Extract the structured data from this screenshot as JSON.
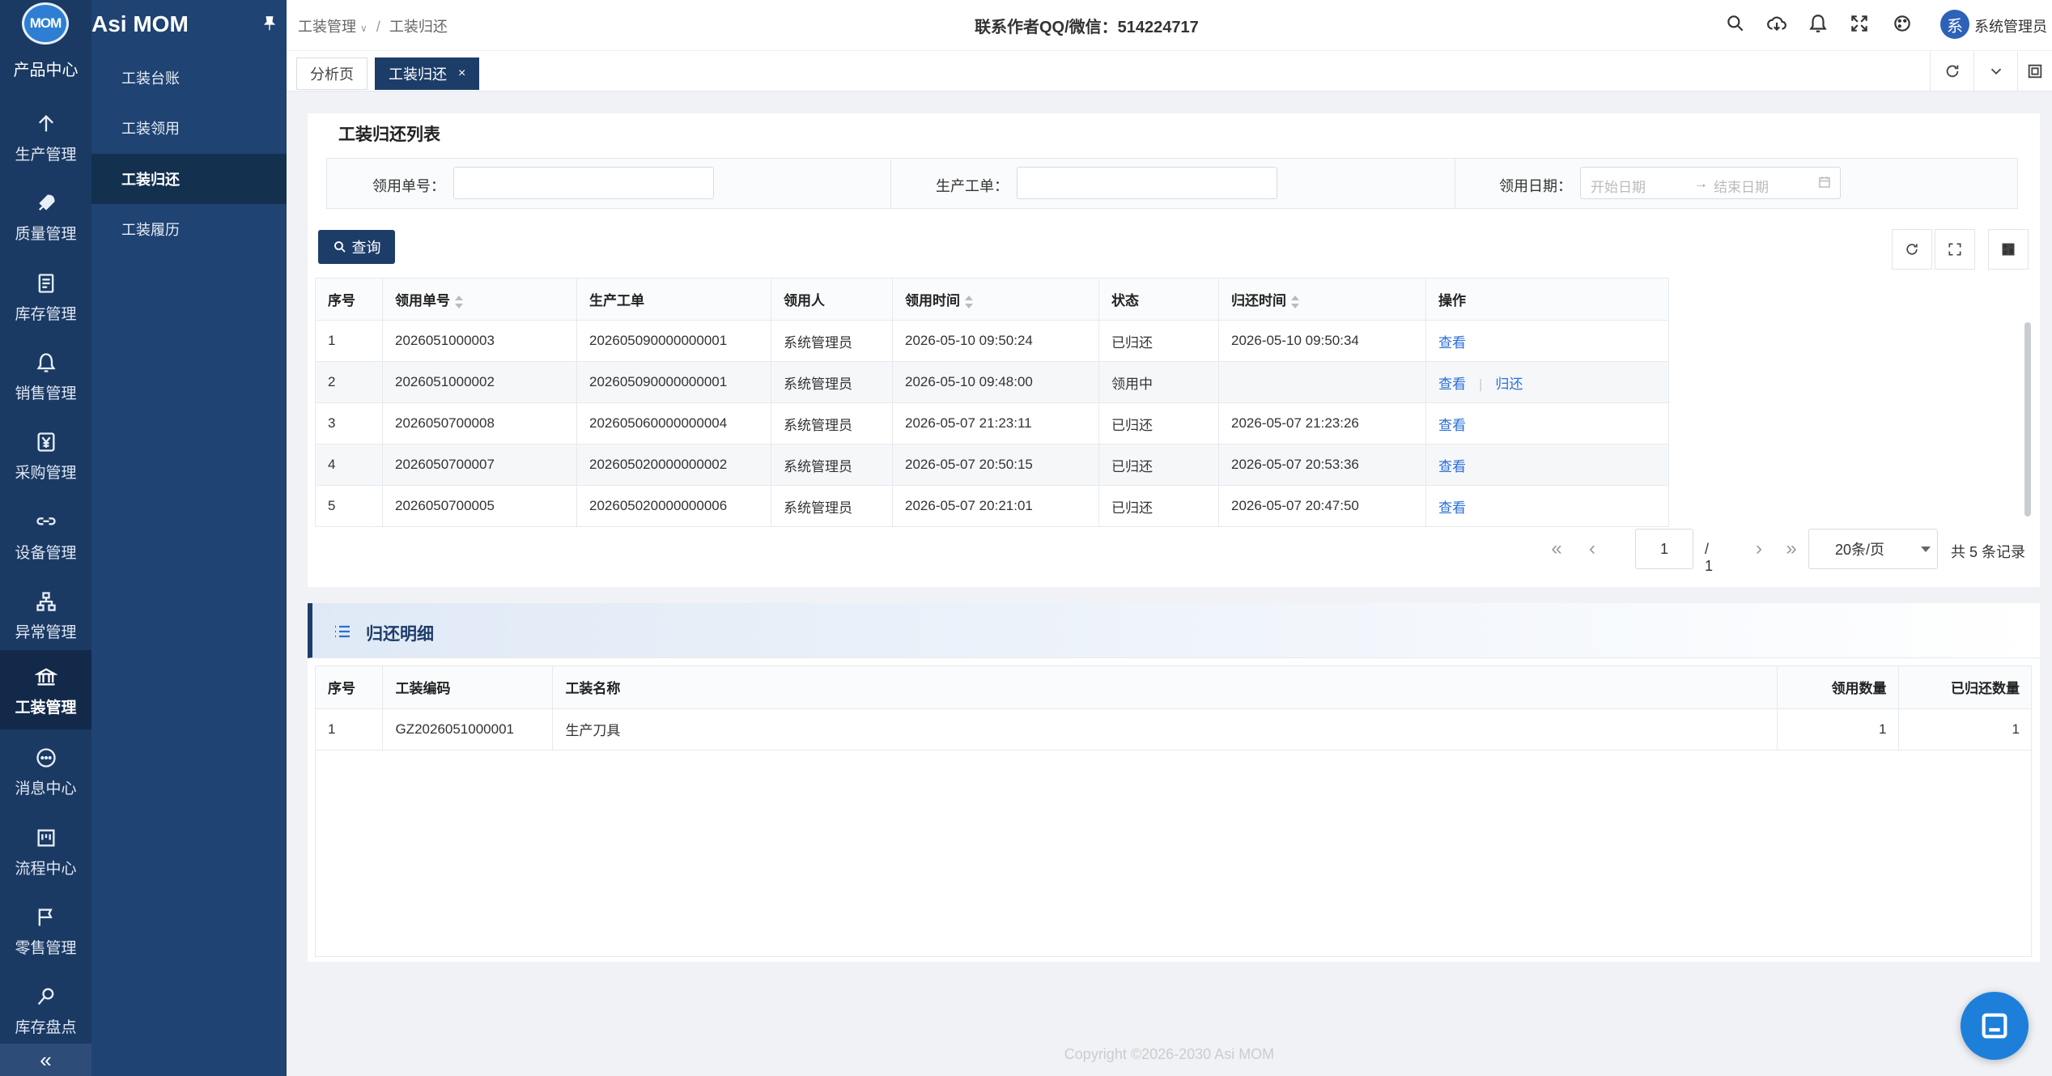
{
  "app": {
    "name": "Asi MOM",
    "logo_text": "MOM"
  },
  "rail": {
    "top_label": "产品中心",
    "items": [
      {
        "label": "生产管理",
        "icon": "arrow-up-icon"
      },
      {
        "label": "质量管理",
        "icon": "rocket-icon"
      },
      {
        "label": "库存管理",
        "icon": "clipboard-icon"
      },
      {
        "label": "销售管理",
        "icon": "bell-money-icon"
      },
      {
        "label": "采购管理",
        "icon": "yen-icon"
      },
      {
        "label": "设备管理",
        "icon": "link-icon"
      },
      {
        "label": "异常管理",
        "icon": "org-chart-icon"
      },
      {
        "label": "工装管理",
        "icon": "bank-icon"
      },
      {
        "label": "消息中心",
        "icon": "chat-icon"
      },
      {
        "label": "流程中心",
        "icon": "board-icon"
      },
      {
        "label": "零售管理",
        "icon": "flag-icon"
      },
      {
        "label": "库存盘点",
        "icon": "search-doc-icon"
      }
    ],
    "collapse_label": "«"
  },
  "submenu": {
    "items": [
      "工装台账",
      "工装领用",
      "工装归还",
      "工装履历"
    ],
    "active_index": 2
  },
  "header": {
    "breadcrumb": [
      "工装管理",
      "工装归还"
    ],
    "contact": "联系作者QQ/微信：514224717",
    "user_avatar": "系",
    "user_name": "系统管理员"
  },
  "tabs": [
    {
      "label": "分析页"
    },
    {
      "label": "工装归还",
      "close": "×"
    }
  ],
  "list": {
    "title": "工装归还列表",
    "filters": {
      "order_no_label": "领用单号：",
      "work_order_label": "生产工单：",
      "date_label": "领用日期：",
      "date_start_placeholder": "开始日期",
      "date_arrow": "→",
      "date_end_placeholder": "结束日期"
    },
    "query_label": "查询",
    "columns": [
      "序号",
      "领用单号",
      "生产工单",
      "领用人",
      "领用时间",
      "状态",
      "归还时间",
      "操作"
    ],
    "rows": [
      {
        "idx": "1",
        "order_no": "2026051000003",
        "work_order": "202605090000000001",
        "user": "系统管理员",
        "take_time": "2026-05-10 09:50:24",
        "status": "已归还",
        "return_time": "2026-05-10 09:50:34",
        "view": "查看",
        "return": ""
      },
      {
        "idx": "2",
        "order_no": "2026051000002",
        "work_order": "202605090000000001",
        "user": "系统管理员",
        "take_time": "2026-05-10 09:48:00",
        "status": "领用中",
        "return_time": "",
        "view": "查看",
        "return": "归还"
      },
      {
        "idx": "3",
        "order_no": "2026050700008",
        "work_order": "202605060000000004",
        "user": "系统管理员",
        "take_time": "2026-05-07 21:23:11",
        "status": "已归还",
        "return_time": "2026-05-07 21:23:26",
        "view": "查看",
        "return": ""
      },
      {
        "idx": "4",
        "order_no": "2026050700007",
        "work_order": "202605020000000002",
        "user": "系统管理员",
        "take_time": "2026-05-07 20:50:15",
        "status": "已归还",
        "return_time": "2026-05-07 20:53:36",
        "view": "查看",
        "return": ""
      },
      {
        "idx": "5",
        "order_no": "2026050700005",
        "work_order": "202605020000000006",
        "user": "系统管理员",
        "take_time": "2026-05-07 20:21:01",
        "status": "已归还",
        "return_time": "2026-05-07 20:47:50",
        "view": "查看",
        "return": ""
      }
    ],
    "pager": {
      "current_page": "1",
      "total_pages": "/ 1",
      "page_size": "20条/页",
      "total": "共 5 条记录"
    }
  },
  "detail": {
    "title": "归还明细",
    "columns": [
      "序号",
      "工装编码",
      "工装名称",
      "领用数量",
      "已归还数量"
    ],
    "rows": [
      {
        "idx": "1",
        "code": "GZ2026051000001",
        "name": "生产刀具",
        "qty": "1",
        "returned": "1"
      }
    ]
  },
  "footer": "Copyright ©2026-2030 Asi MOM",
  "colors": {
    "rail": "#1b3a63",
    "submenu": "#1f4372",
    "primary": "#1d3d69",
    "link": "#2a6fd6"
  }
}
